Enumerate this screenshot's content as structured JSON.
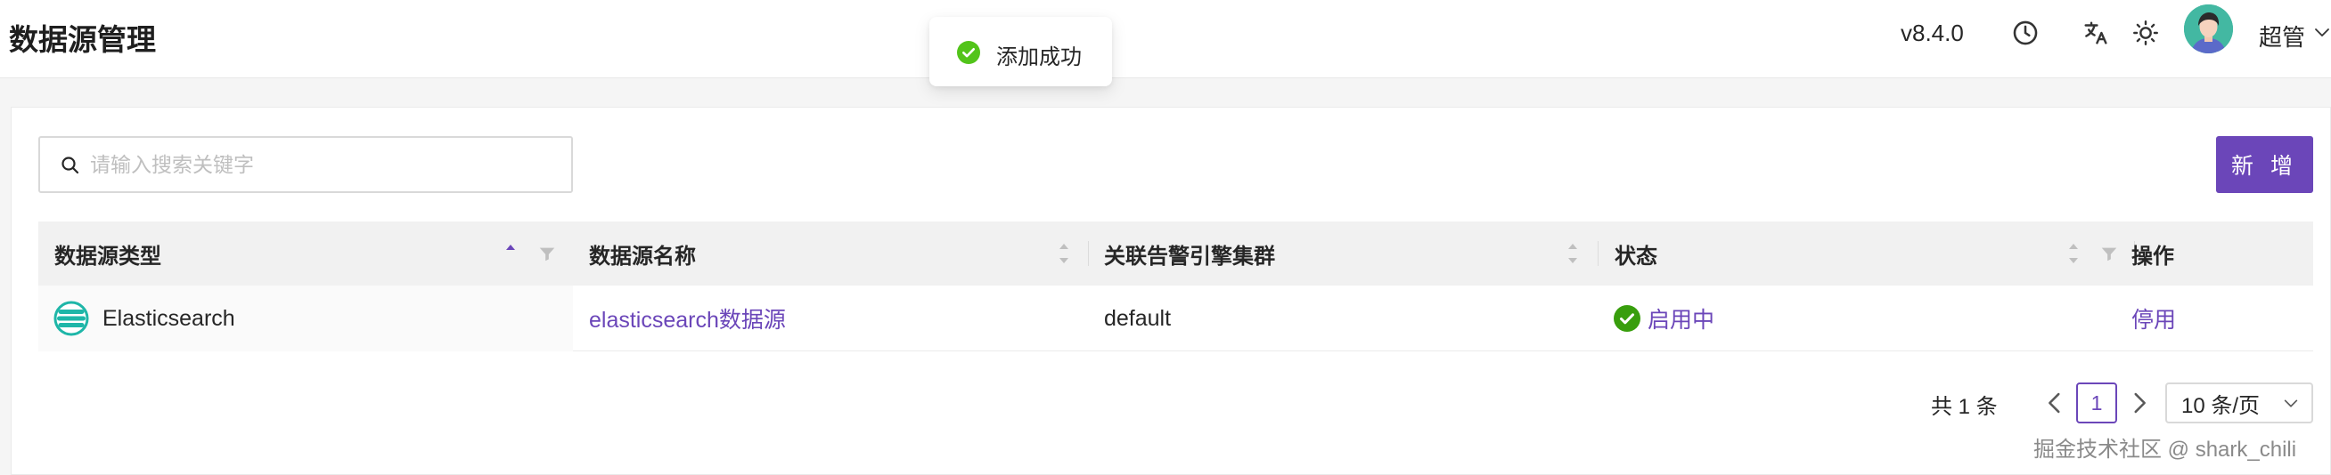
{
  "header": {
    "title": "数据源管理",
    "version": "v8.4.0",
    "icons": [
      "clock-icon",
      "translate-icon",
      "sun-icon"
    ],
    "username": "超管"
  },
  "toast": {
    "message": "添加成功",
    "icon": "check-circle-icon",
    "color": "#52c41a"
  },
  "toolbar": {
    "search_placeholder": "请输入搜索关键字",
    "search_value": "",
    "add_label": "新 增",
    "accent": "#6b46b9"
  },
  "table": {
    "columns": [
      "数据源类型",
      "数据源名称",
      "关联告警引擎集群",
      "状态",
      "操作"
    ],
    "rows": [
      {
        "type": "Elasticsearch",
        "type_icon": "elasticsearch-logo-icon",
        "name": "elasticsearch数据源",
        "cluster": "default",
        "status": "启用中",
        "status_icon": "check-circle-icon",
        "action": "停用"
      }
    ]
  },
  "pagination": {
    "total": "共 1 条",
    "current_page": "1",
    "page_size": "10 条/页"
  },
  "watermark": "掘金技术社区 @ shark_chili"
}
